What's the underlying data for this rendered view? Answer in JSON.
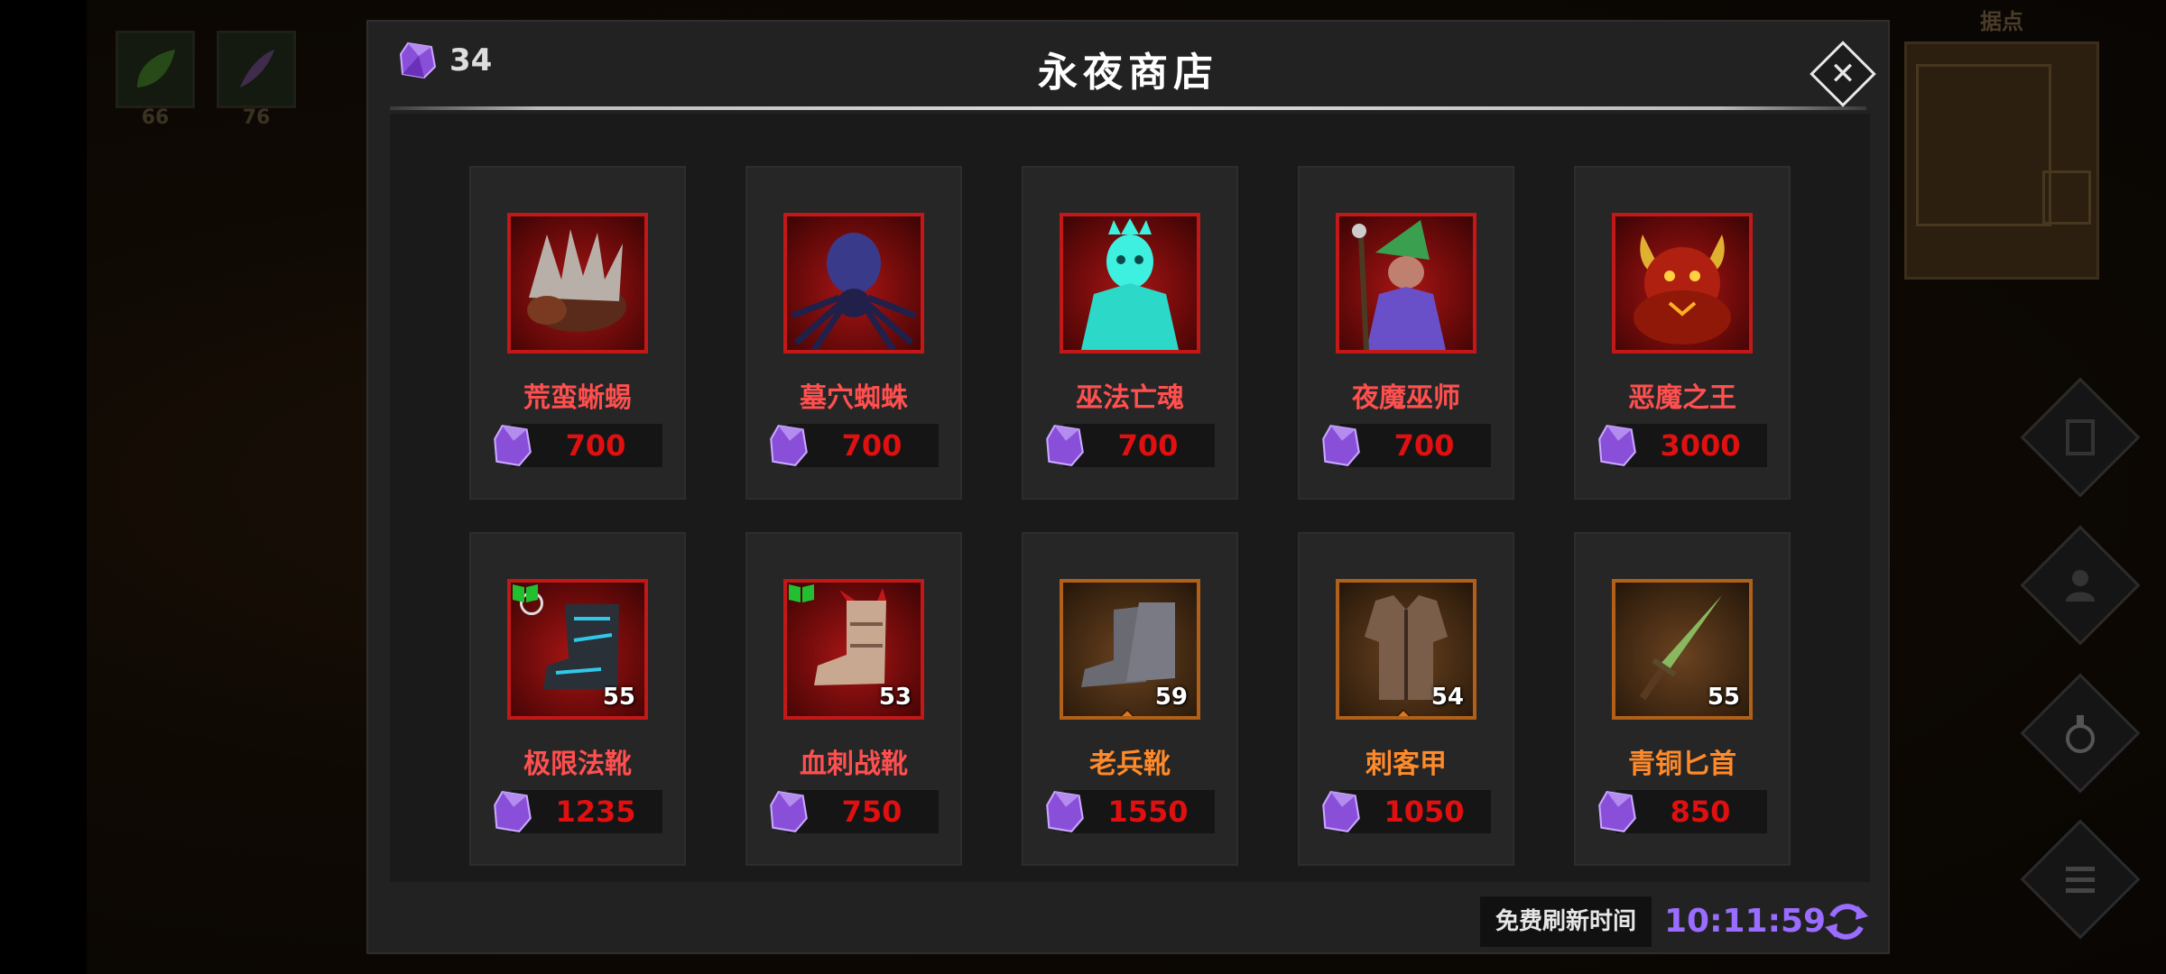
{
  "background": {
    "skills": [
      {
        "icon": "green-leaf-skill-icon",
        "count": "66"
      },
      {
        "icon": "purple-feather-skill-icon",
        "count": "76"
      }
    ],
    "minimap_title": "据点"
  },
  "shop": {
    "title": "永夜商店",
    "currency_amount": "34",
    "close_icon": "close-x-icon",
    "items": [
      {
        "name": "荒蛮蜥蜴",
        "price": "700",
        "frame": "red",
        "icon": "lizard-beast-portrait"
      },
      {
        "name": "墓穴蜘蛛",
        "price": "700",
        "frame": "red",
        "icon": "spider-portrait"
      },
      {
        "name": "巫法亡魂",
        "price": "700",
        "frame": "red",
        "icon": "ghost-wraith-portrait"
      },
      {
        "name": "夜魔巫师",
        "price": "700",
        "frame": "red",
        "icon": "goblin-wizard-portrait"
      },
      {
        "name": "恶魔之王",
        "price": "3000",
        "frame": "red",
        "icon": "demon-lord-portrait"
      },
      {
        "name": "极限法靴",
        "price": "1235",
        "frame": "red",
        "level": "55",
        "icon": "blue-boots-icon"
      },
      {
        "name": "血刺战靴",
        "price": "750",
        "frame": "red",
        "level": "53",
        "icon": "spiked-boots-icon"
      },
      {
        "name": "老兵靴",
        "price": "1550",
        "frame": "orange",
        "level": "59",
        "icon": "veteran-boots-icon"
      },
      {
        "name": "刺客甲",
        "price": "1050",
        "frame": "orange",
        "level": "54",
        "icon": "assassin-armor-icon"
      },
      {
        "name": "青铜匕首",
        "price": "850",
        "frame": "orange",
        "level": "55",
        "icon": "bronze-dagger-icon"
      }
    ],
    "refresh_label": "免费刷新时间",
    "refresh_time": "10:11:59"
  },
  "colors": {
    "price": "#e01010",
    "name_red": "#ff4f4f",
    "name_orange": "#ff8a2a",
    "timer": "#9a6cff",
    "gem": "#8a4fd8"
  }
}
